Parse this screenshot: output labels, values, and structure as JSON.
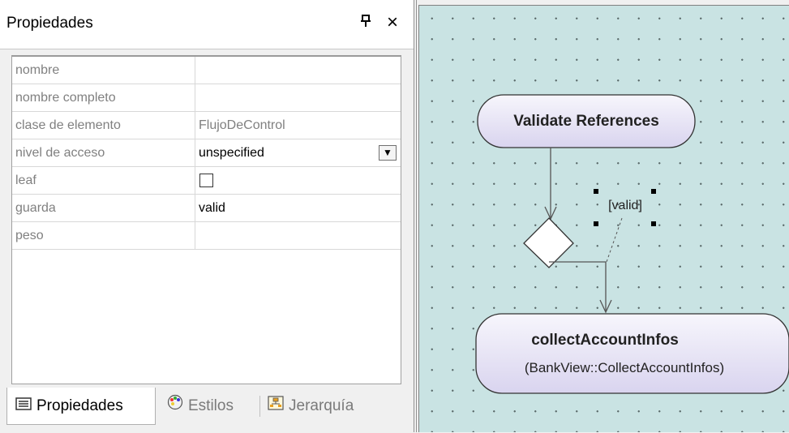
{
  "panel": {
    "title": "Propiedades",
    "pin_icon": "pin-icon",
    "close_icon": "close-icon",
    "pin_glyph": "ᵽ",
    "close_glyph": "×"
  },
  "properties": [
    {
      "name": "nombre",
      "value": ""
    },
    {
      "name": "nombre completo",
      "value": ""
    },
    {
      "name": "clase de elemento",
      "value": "FlujoDeControl"
    },
    {
      "name": "nivel de acceso",
      "value": "unspecified"
    },
    {
      "name": "leaf",
      "value": ""
    },
    {
      "name": "guarda",
      "value": "valid"
    },
    {
      "name": "peso",
      "value": ""
    }
  ],
  "leaf_checked": false,
  "dropdown_glyph": "▼",
  "tabs": [
    {
      "label": "Propiedades",
      "icon": "properties-list-icon",
      "active": true
    },
    {
      "label": "Estilos",
      "icon": "palette-icon",
      "active": false
    },
    {
      "label": "Jerarquía",
      "icon": "hierarchy-icon",
      "active": false
    }
  ],
  "diagram": {
    "action1": "Validate References",
    "guard": "[valid]",
    "action2_title": "collectAccountInfos",
    "action2_subtitle": "(BankView::CollectAccountInfos)"
  },
  "colors": {
    "canvas_bg": "#c9e3e3",
    "action_fill": "#e0dcf2",
    "action_stroke": "#333333"
  }
}
